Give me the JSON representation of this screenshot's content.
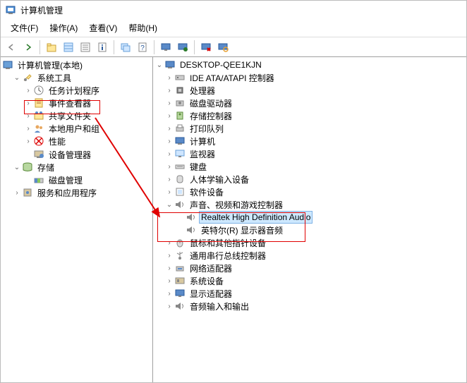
{
  "window": {
    "title": "计算机管理"
  },
  "menu": {
    "file": "文件(F)",
    "action": "操作(A)",
    "view": "查看(V)",
    "help": "帮助(H)"
  },
  "toolbar_icons": [
    "back",
    "forward",
    "up",
    "folder",
    "list",
    "properties",
    "details",
    "window-list",
    "help",
    "refresh-monitor",
    "refresh",
    "uninstall",
    "scan"
  ],
  "left_tree": {
    "root": "计算机管理(本地)",
    "system_tools": "系统工具",
    "task_scheduler": "任务计划程序",
    "event_viewer": "事件查看器",
    "shared_folders": "共享文件夹",
    "local_users": "本地用户和组",
    "performance": "性能",
    "device_manager": "设备管理器",
    "storage": "存储",
    "disk_management": "磁盘管理",
    "services_apps": "服务和应用程序"
  },
  "right_tree": {
    "root": "DESKTOP-QEE1KJN",
    "items": [
      {
        "label": "IDE ATA/ATAPI 控制器",
        "icon": "ide"
      },
      {
        "label": "处理器",
        "icon": "cpu"
      },
      {
        "label": "磁盘驱动器",
        "icon": "disk"
      },
      {
        "label": "存储控制器",
        "icon": "storage"
      },
      {
        "label": "打印队列",
        "icon": "printer"
      },
      {
        "label": "计算机",
        "icon": "computer"
      },
      {
        "label": "监视器",
        "icon": "monitor"
      },
      {
        "label": "键盘",
        "icon": "keyboard"
      },
      {
        "label": "人体学输入设备",
        "icon": "hid"
      },
      {
        "label": "软件设备",
        "icon": "software"
      }
    ],
    "sound": {
      "label": "声音、视频和游戏控制器",
      "children": [
        "Realtek High Definition Audio",
        "英特尔(R) 显示器音频"
      ]
    },
    "items2": [
      {
        "label": "鼠标和其他指针设备",
        "icon": "mouse"
      },
      {
        "label": "通用串行总线控制器",
        "icon": "usb"
      },
      {
        "label": "网络适配器",
        "icon": "network"
      },
      {
        "label": "系统设备",
        "icon": "system"
      },
      {
        "label": "显示适配器",
        "icon": "display"
      },
      {
        "label": "音频输入和输出",
        "icon": "audio"
      }
    ]
  }
}
